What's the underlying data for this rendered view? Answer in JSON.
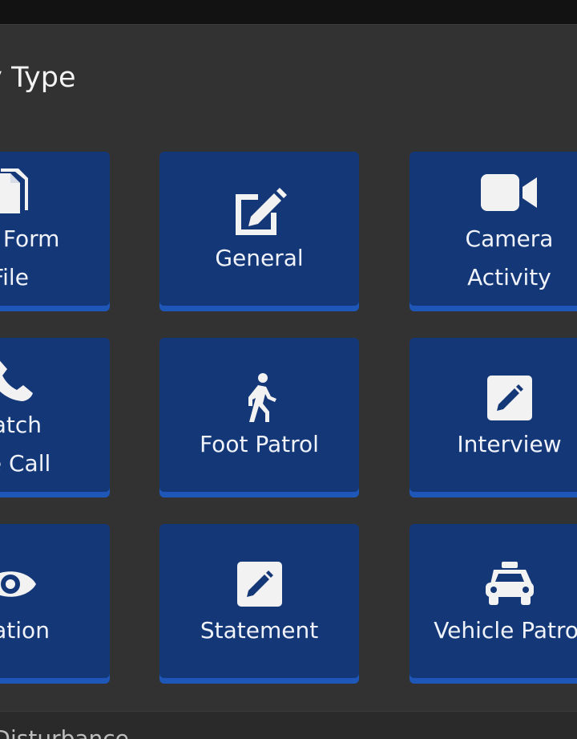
{
  "dialog": {
    "title": "ntry Type"
  },
  "tiles": [
    {
      "line1": "om Form",
      "line2": "File",
      "icon": "file-icon"
    },
    {
      "line1": "General",
      "line2": "",
      "icon": "pen-to-square-icon"
    },
    {
      "line1": "Camera",
      "line2": "Activity",
      "icon": "video-camera-icon"
    },
    {
      "line1": "patch",
      "line2": "ice Call",
      "icon": "phone-icon"
    },
    {
      "line1": "Foot Patrol",
      "line2": "",
      "icon": "walking-person-icon"
    },
    {
      "line1": "Interview",
      "line2": "",
      "icon": "edit-square-icon"
    },
    {
      "line1": "rvation",
      "line2": "",
      "icon": "eye-icon"
    },
    {
      "line1": "Statement",
      "line2": "",
      "icon": "edit-square-icon"
    },
    {
      "line1": "Vehicle Patrol",
      "line2": "",
      "icon": "taxi-icon"
    }
  ],
  "bottom": {
    "text": "/Disturbance"
  },
  "colors": {
    "tile": "#143778",
    "tile_accent": "#1f57b8",
    "dialog": "#323232",
    "background": "#121212"
  }
}
